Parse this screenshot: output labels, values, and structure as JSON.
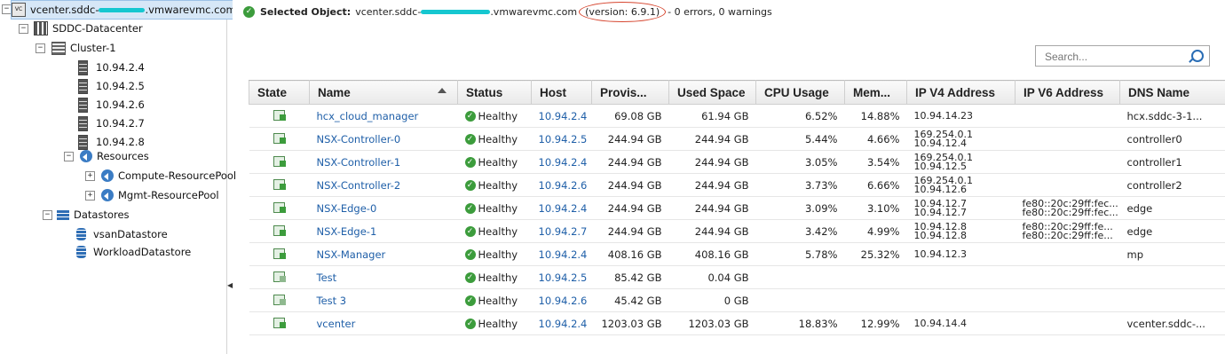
{
  "tree": {
    "root_label": "vcenter.sddc-",
    "root_label_tail": ".vmwarevmc.com",
    "datacenter": "SDDC-Datacenter",
    "cluster": "Cluster-1",
    "hosts": [
      "10.94.2.4",
      "10.94.2.5",
      "10.94.2.6",
      "10.94.2.7",
      "10.94.2.8"
    ],
    "resources": "Resources",
    "resource_pools": [
      "Compute-ResourcePool",
      "Mgmt-ResourcePool"
    ],
    "datastores": "Datastores",
    "datastore_items": [
      "vsanDatastore",
      "WorkloadDatastore"
    ]
  },
  "status_bar": {
    "label": "Selected Object:",
    "object_prefix": "vcenter.sddc-",
    "object_suffix": ".vmwarevmc.com",
    "version": "(version: 6.9.1)",
    "summary": "- 0 errors, 0 warnings"
  },
  "search": {
    "placeholder": "Search..."
  },
  "table": {
    "columns": [
      "State",
      "Name",
      "Status",
      "Host",
      "Provis...",
      "Used Space",
      "CPU Usage",
      "Mem...",
      "IP V4 Address",
      "IP V6 Address",
      "DNS Name"
    ],
    "rows": [
      {
        "state": "on",
        "name": "hcx_cloud_manager",
        "status": "Healthy",
        "host": "10.94.2.4",
        "prov": "69.08 GB",
        "used": "61.94 GB",
        "cpu": "6.52%",
        "mem": "14.88%",
        "ipv4": [
          "10.94.14.23"
        ],
        "ipv6": [],
        "dns": "hcx.sddc-3-1..."
      },
      {
        "state": "on",
        "name": "NSX-Controller-0",
        "status": "Healthy",
        "host": "10.94.2.5",
        "prov": "244.94 GB",
        "used": "244.94 GB",
        "cpu": "5.44%",
        "mem": "4.66%",
        "ipv4": [
          "169.254.0.1",
          "10.94.12.4"
        ],
        "ipv6": [],
        "dns": "controller0"
      },
      {
        "state": "on",
        "name": "NSX-Controller-1",
        "status": "Healthy",
        "host": "10.94.2.4",
        "prov": "244.94 GB",
        "used": "244.94 GB",
        "cpu": "3.05%",
        "mem": "3.54%",
        "ipv4": [
          "169.254.0.1",
          "10.94.12.5"
        ],
        "ipv6": [],
        "dns": "controller1"
      },
      {
        "state": "on",
        "name": "NSX-Controller-2",
        "status": "Healthy",
        "host": "10.94.2.6",
        "prov": "244.94 GB",
        "used": "244.94 GB",
        "cpu": "3.73%",
        "mem": "6.66%",
        "ipv4": [
          "169.254.0.1",
          "10.94.12.6"
        ],
        "ipv6": [],
        "dns": "controller2"
      },
      {
        "state": "on",
        "name": "NSX-Edge-0",
        "status": "Healthy",
        "host": "10.94.2.4",
        "prov": "244.94 GB",
        "used": "244.94 GB",
        "cpu": "3.09%",
        "mem": "3.10%",
        "ipv4": [
          "10.94.12.7",
          "10.94.12.7"
        ],
        "ipv6": [
          "fe80::20c:29ff:fec...",
          "fe80::20c:29ff:fec..."
        ],
        "dns": "edge"
      },
      {
        "state": "on",
        "name": "NSX-Edge-1",
        "status": "Healthy",
        "host": "10.94.2.7",
        "prov": "244.94 GB",
        "used": "244.94 GB",
        "cpu": "3.42%",
        "mem": "4.99%",
        "ipv4": [
          "10.94.12.8",
          "10.94.12.8"
        ],
        "ipv6": [
          "fe80::20c:29ff:fe...",
          "fe80::20c:29ff:fe..."
        ],
        "dns": "edge"
      },
      {
        "state": "on",
        "name": "NSX-Manager",
        "status": "Healthy",
        "host": "10.94.2.4",
        "prov": "408.16 GB",
        "used": "408.16 GB",
        "cpu": "5.78%",
        "mem": "25.32%",
        "ipv4": [
          "10.94.12.3"
        ],
        "ipv6": [],
        "dns": "mp"
      },
      {
        "state": "off",
        "name": "Test",
        "status": "Healthy",
        "host": "10.94.2.5",
        "prov": "85.42 GB",
        "used": "0.04 GB",
        "cpu": "",
        "mem": "",
        "ipv4": [],
        "ipv6": [],
        "dns": ""
      },
      {
        "state": "off",
        "name": "Test 3",
        "status": "Healthy",
        "host": "10.94.2.6",
        "prov": "45.42 GB",
        "used": "0 GB",
        "cpu": "",
        "mem": "",
        "ipv4": [],
        "ipv6": [],
        "dns": ""
      },
      {
        "state": "on",
        "name": "vcenter",
        "status": "Healthy",
        "host": "10.94.2.4",
        "prov": "1203.03 GB",
        "used": "1203.03 GB",
        "cpu": "18.83%",
        "mem": "12.99%",
        "ipv4": [
          "10.94.14.4"
        ],
        "ipv6": [],
        "dns": "vcenter.sddc-..."
      }
    ]
  },
  "colors": {
    "accent": "#1f5fa8",
    "healthy": "#3c9c3c",
    "annotation": "#d6452e",
    "redaction": "#16c7d0"
  }
}
